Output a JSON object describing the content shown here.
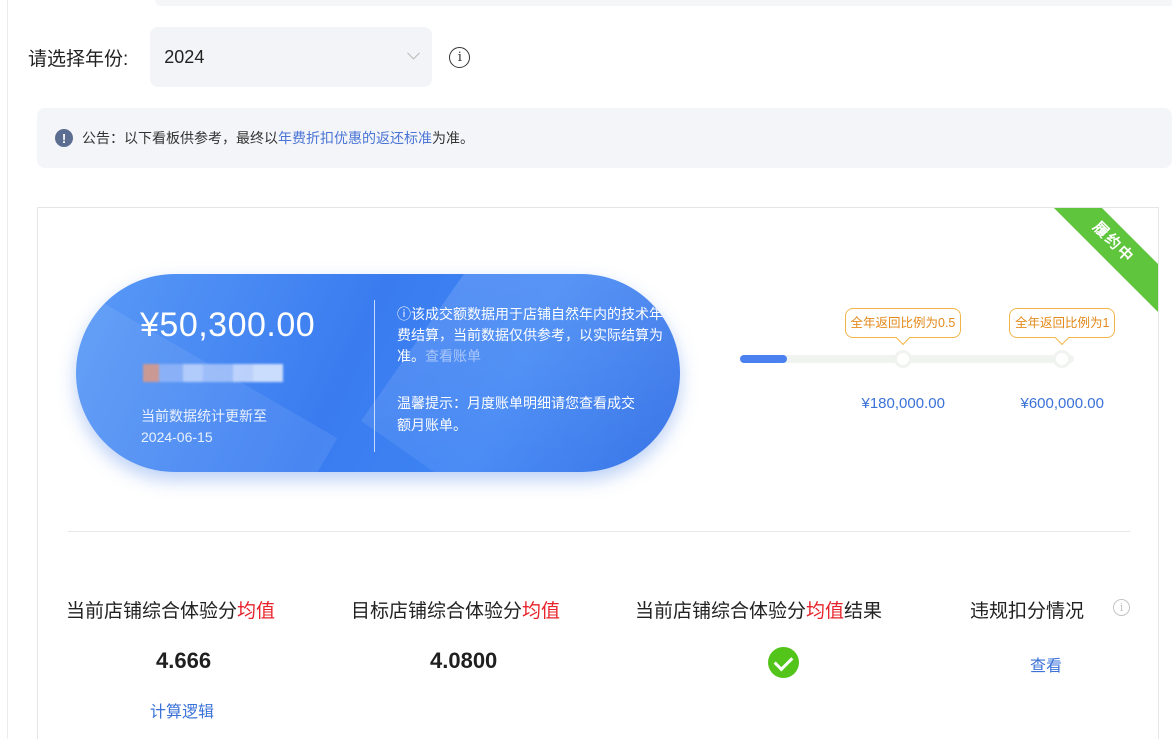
{
  "year_filter": {
    "label": "请选择年份:",
    "selected": "2024",
    "info_icon": "info-circle-icon"
  },
  "notice": {
    "icon": "exclamation-circle-icon",
    "prefix": "公告：以下看板供参考，最终以",
    "link": "年费折扣优惠的返还标准",
    "suffix": "为准。"
  },
  "status_ribbon": {
    "label": "履约中",
    "color": "#5fc53c"
  },
  "summary": {
    "amount": "¥50,300.00",
    "update_line1": "当前数据统计更新至",
    "update_date": "2024-06-15",
    "note_text": "ⓘ该成交额数据用于店铺自然年内的技术年费结算，当前数据仅供参考，以实际结算为准。",
    "note_link": "查看账单",
    "tip": "温馨提示：月度账单明细请您查看成交额月账单。"
  },
  "progress": {
    "current": 50300,
    "max": 600000,
    "milestones": [
      {
        "tag": "全年返回比例为0.5",
        "amount": "¥180,000.00",
        "value": 180000
      },
      {
        "tag": "全年返回比例为1",
        "amount": "¥600,000.00",
        "value": 600000
      }
    ]
  },
  "metrics": {
    "current_score": {
      "title_pre": "当前店铺综合体验分",
      "title_red": "均值",
      "title_post": "",
      "value": "4.666",
      "link": "计算逻辑"
    },
    "target_score": {
      "title_pre": "目标店铺综合体验分",
      "title_red": "均值",
      "title_post": "",
      "value": "4.0800"
    },
    "result": {
      "title_pre": "当前店铺综合体验分",
      "title_red": "均值",
      "title_post": "结果",
      "status_icon": "check-circle-icon"
    },
    "violations": {
      "title": "违规扣分情况",
      "link": "查看",
      "info_icon": "info-circle-icon"
    }
  },
  "colors": {
    "accent": "#3a72d8",
    "highlight": "#e8222a",
    "success": "#52c41a",
    "milestone": "#f2b54a"
  }
}
